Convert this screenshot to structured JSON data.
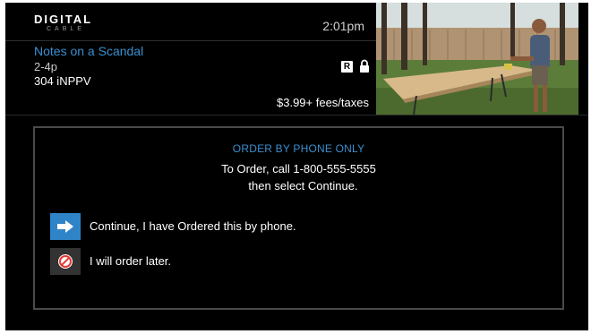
{
  "header": {
    "logo_main": "DIGITAL",
    "logo_sub": "CABLE",
    "time": "2:01pm",
    "program": {
      "title": "Notes on a Scandal",
      "time": "2-4p",
      "channel": "304 iNPPV",
      "rating": "R",
      "price": "$3.99+ fees/taxes"
    }
  },
  "dialog": {
    "heading": "ORDER BY PHONE ONLY",
    "line1": "To Order, call 1-800-555-5555",
    "line2": "then select Continue.",
    "options": [
      {
        "label": "Continue, I have Ordered this by phone.",
        "icon": "arrow-right-icon"
      },
      {
        "label": "I will order later.",
        "icon": "no-entry-icon"
      }
    ]
  },
  "colors": {
    "accent": "#3a8fd0",
    "selected_option": "#2f84c8",
    "option_bg": "#333333",
    "no_entry": "#e53935"
  }
}
